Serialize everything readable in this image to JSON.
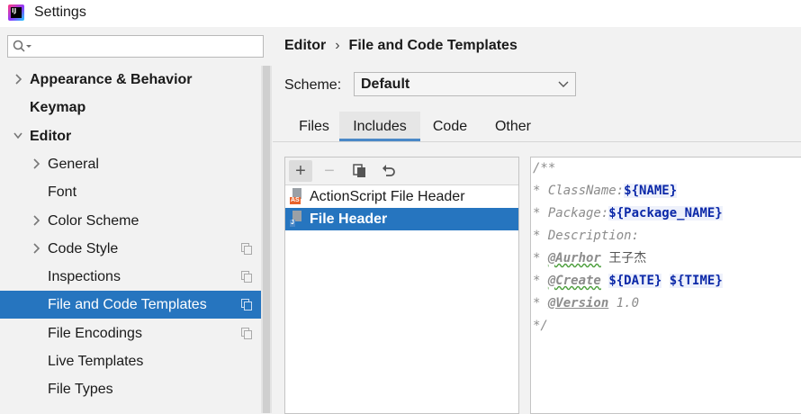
{
  "window": {
    "title": "Settings",
    "app_icon": "intellij-idea-icon",
    "app_icon_text": "IJ"
  },
  "search": {
    "value": "",
    "placeholder": "",
    "icon": "search-icon"
  },
  "sidebar": {
    "items": [
      {
        "label": "Appearance & Behavior",
        "bold": true,
        "expandable": true,
        "expanded": false,
        "level": 0
      },
      {
        "label": "Keymap",
        "bold": true,
        "expandable": false,
        "level": 0
      },
      {
        "label": "Editor",
        "bold": true,
        "expandable": true,
        "expanded": true,
        "level": 0
      },
      {
        "label": "General",
        "bold": false,
        "expandable": true,
        "expanded": false,
        "level": 1
      },
      {
        "label": "Font",
        "bold": false,
        "expandable": false,
        "level": 1
      },
      {
        "label": "Color Scheme",
        "bold": false,
        "expandable": true,
        "expanded": false,
        "level": 1
      },
      {
        "label": "Code Style",
        "bold": false,
        "expandable": true,
        "expanded": false,
        "level": 1,
        "project_icon": true
      },
      {
        "label": "Inspections",
        "bold": false,
        "expandable": false,
        "level": 1,
        "project_icon": true
      },
      {
        "label": "File and Code Templates",
        "bold": false,
        "expandable": false,
        "level": 1,
        "project_icon": true,
        "selected": true
      },
      {
        "label": "File Encodings",
        "bold": false,
        "expandable": false,
        "level": 1,
        "project_icon": true
      },
      {
        "label": "Live Templates",
        "bold": false,
        "expandable": false,
        "level": 1
      },
      {
        "label": "File Types",
        "bold": false,
        "expandable": false,
        "level": 1
      }
    ]
  },
  "breadcrumb": {
    "parent": "Editor",
    "separator": "›",
    "current": "File and Code Templates"
  },
  "scheme": {
    "label": "Scheme:",
    "value": "Default"
  },
  "tabs": [
    {
      "label": "Files",
      "active": false
    },
    {
      "label": "Includes",
      "active": true
    },
    {
      "label": "Code",
      "active": false
    },
    {
      "label": "Other",
      "active": false
    }
  ],
  "list_toolbar": {
    "add": "+",
    "remove": "−",
    "copy": "copy-icon",
    "reset": "undo-icon"
  },
  "templates": [
    {
      "label": "ActionScript File Header",
      "tag": "AS",
      "tag_color": "#e8632b",
      "selected": false
    },
    {
      "label": "File Header",
      "tag": "J",
      "tag_color": "#4a88c7",
      "selected": true
    }
  ],
  "editor": {
    "lines": [
      [
        {
          "t": "/**",
          "k": "cm"
        }
      ],
      [
        {
          "t": "* ClassName:",
          "k": "cm"
        },
        {
          "t": "${NAME}",
          "k": "var"
        }
      ],
      [
        {
          "t": "* Package:",
          "k": "cm"
        },
        {
          "t": "${Package_NAME}",
          "k": "var"
        }
      ],
      [
        {
          "t": "* Description:",
          "k": "cm"
        }
      ],
      [
        {
          "t": "* ",
          "k": "cm"
        },
        {
          "t": "@Aurhor",
          "k": "tag-doc wavy"
        },
        {
          "t": " ",
          "k": "cm"
        },
        {
          "t": "王子杰",
          "k": "cn"
        }
      ],
      [
        {
          "t": "* ",
          "k": "cm"
        },
        {
          "t": "@Create",
          "k": "tag-doc wavy"
        },
        {
          "t": " ",
          "k": "cm"
        },
        {
          "t": "${DATE}",
          "k": "var"
        },
        {
          "t": " ",
          "k": "cm"
        },
        {
          "t": "${TIME}",
          "k": "var"
        }
      ],
      [
        {
          "t": "* ",
          "k": "cm"
        },
        {
          "t": "@Version",
          "k": "tag-doc"
        },
        {
          "t": " 1.0",
          "k": "cm"
        }
      ],
      [
        {
          "t": "*/",
          "k": "cm"
        }
      ]
    ]
  }
}
